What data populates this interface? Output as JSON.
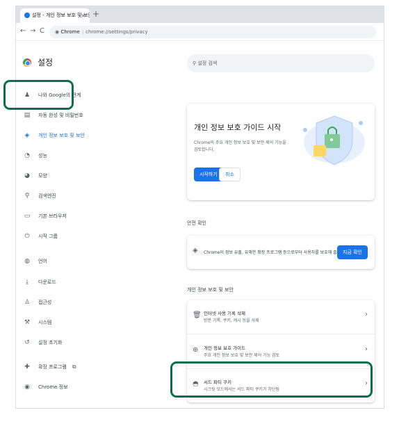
{
  "browser": {
    "tab_title": "설정 - 개인 정보 보호 및 보안",
    "tab_close": "×",
    "new_tab": "+",
    "back": "←",
    "forward": "→",
    "reload": "C",
    "address_site": "Chrome",
    "address_sep": "|",
    "address_path": "chrome://settings/privacy"
  },
  "sidebar": {
    "title": "설정",
    "items": [
      {
        "label": "나와 Google의 관계",
        "icon": "person-icon",
        "glyph": "♟"
      },
      {
        "label": "자동 완성 및 비밀번호",
        "icon": "clipboard-icon",
        "glyph": "▤"
      },
      {
        "label": "개인 정보 보호 및 보안",
        "icon": "shield-icon",
        "glyph": "◈"
      },
      {
        "label": "성능",
        "icon": "speedometer-icon",
        "glyph": "◔"
      },
      {
        "label": "모양",
        "icon": "palette-icon",
        "glyph": "◕"
      },
      {
        "label": "검색엔진",
        "icon": "search-icon",
        "glyph": "⚲"
      },
      {
        "label": "기본 브라우저",
        "icon": "browser-icon",
        "glyph": "▭"
      },
      {
        "label": "시작 그룹",
        "icon": "power-icon",
        "glyph": "⏻"
      },
      {
        "label": "언어",
        "icon": "globe-icon",
        "glyph": "◍"
      },
      {
        "label": "다운로드",
        "icon": "download-icon",
        "glyph": "⤓"
      },
      {
        "label": "접근성",
        "icon": "accessibility-icon",
        "glyph": "♙"
      },
      {
        "label": "시스템",
        "icon": "wrench-icon",
        "glyph": "⚒"
      },
      {
        "label": "설정 초기화",
        "icon": "reset-icon",
        "glyph": "↺"
      },
      {
        "label": "확장 프로그램",
        "icon": "puzzle-icon",
        "glyph": "✚",
        "trailing": "⧉"
      },
      {
        "label": "Chrome 정보",
        "icon": "chrome-icon",
        "glyph": "◉"
      }
    ]
  },
  "main": {
    "search_placeholder": "설정 검색",
    "guide": {
      "title": "개인 정보 보호 가이드 시작",
      "desc": "Chrome의 주요 개인 정보 보호 및 보안 제어 기능을 검토합니다.",
      "start": "시작하기",
      "cancel": "취소"
    },
    "safety": {
      "section": "안전 확인",
      "text": "Chrome이 정보 유출, 유해한 확장 프로그램 등으로부터 사용자를 보호해 줍니다.",
      "button": "지금 확인"
    },
    "privacy": {
      "section": "개인 정보 보호 및 보안",
      "rows": [
        {
          "title": "인터넷 사용 기록 삭제",
          "sub": "방문 기록, 쿠키, 캐시 등을 삭제",
          "icon": "trash-icon",
          "glyph": "🗑"
        },
        {
          "title": "개인 정보 보호 가이드",
          "sub": "주요 개인 정보 보호 및 보안 제어 기능 검토",
          "icon": "compass-icon",
          "glyph": "⊕"
        },
        {
          "title": "서드 파티 쿠키",
          "sub": "시크릿 모드에서는 서드 파티 쿠키가 차단됨",
          "icon": "cookie-icon",
          "glyph": "◓"
        }
      ],
      "chevron": "›"
    }
  },
  "colors": {
    "accent": "#1a73e8",
    "highlight": "#0b6e4f"
  }
}
